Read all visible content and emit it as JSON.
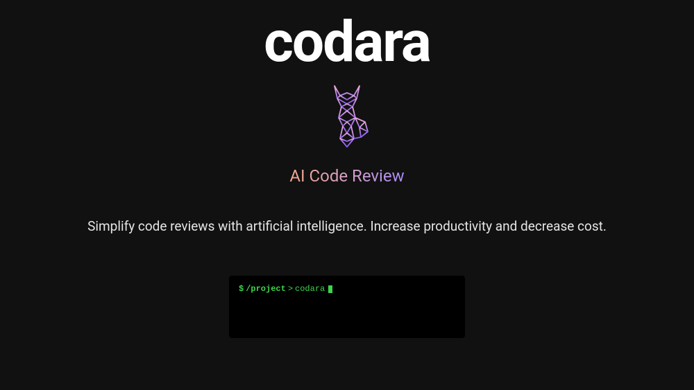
{
  "brand": {
    "name": "codara"
  },
  "hero": {
    "subtitle": "AI Code Review",
    "description": "Simplify code reviews with artificial intelligence. Increase productivity and decrease cost."
  },
  "terminal": {
    "prompt_dollar": "$",
    "prompt_path": "/project",
    "prompt_caret": ">",
    "command": "codara"
  }
}
